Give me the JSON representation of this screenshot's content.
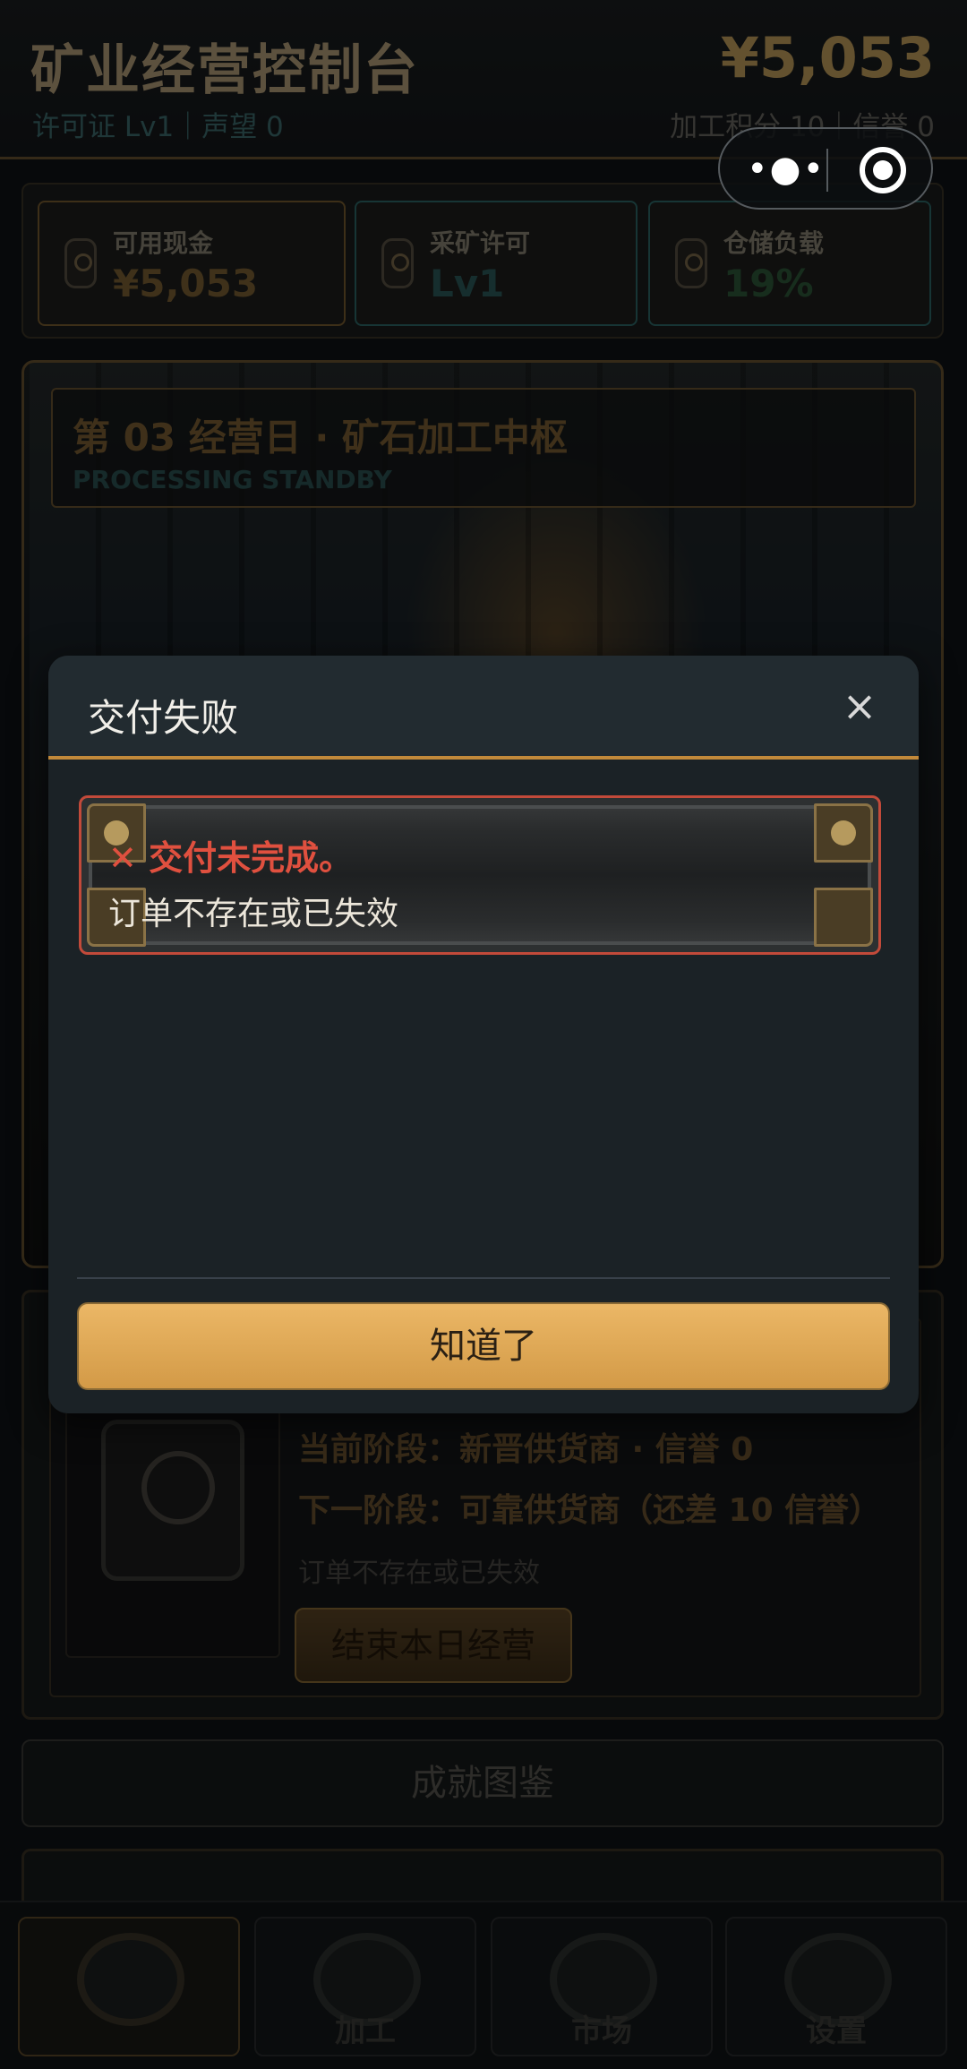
{
  "header": {
    "title": "矿业经营控制台",
    "subtitle_left": "许可证 Lv1｜声望 0",
    "cash": "¥5,053",
    "subtitle_right": "加工积分 10｜信誉 0"
  },
  "stats": [
    {
      "label": "可用现金",
      "value": "¥5,053",
      "color": "#7f6235"
    },
    {
      "label": "采矿许可",
      "value": "Lv1",
      "color": "#2d5c5c"
    },
    {
      "label": "仓储负载",
      "value": "19%",
      "color": "#2f5a3a"
    }
  ],
  "scene": {
    "title": "第 03 经营日 · 矿石加工中枢",
    "subtitle": "PROCESSING STANDBY"
  },
  "card": {
    "current_stage": "当前阶段：新晋供货商 · 信誉 0",
    "next_stage": "下一阶段：可靠供货商（还差 10 信誉）",
    "note": "订单不存在或已失效",
    "end_day_button": "结束本日经营"
  },
  "achievements_button": "成就图鉴",
  "nav": [
    {
      "label": "",
      "icon": "pickaxe-gear-icon"
    },
    {
      "label": "加工",
      "icon": "furnace-gear-icon"
    },
    {
      "label": "市场",
      "icon": "market-gear-icon"
    },
    {
      "label": "设置",
      "icon": "settings-gear-icon"
    }
  ],
  "modal": {
    "title": "交付失败",
    "close_icon": "×",
    "error_heading": "✕ 交付未完成。",
    "error_message": "订单不存在或已失效",
    "ok_button": "知道了"
  },
  "colors": {
    "accent_gold": "#d9a24f",
    "error_red": "#e0503f",
    "modal_bg": "#1b2226"
  }
}
